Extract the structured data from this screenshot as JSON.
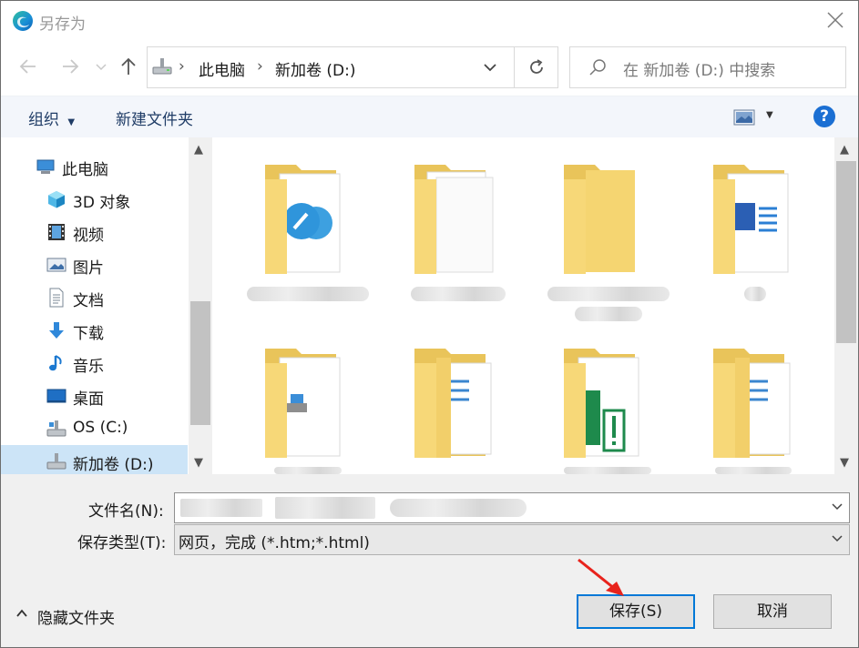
{
  "window": {
    "title": "另存为"
  },
  "nav": {
    "breadcrumb": [
      "此电脑",
      "新加卷 (D:)"
    ],
    "search_placeholder": "在 新加卷 (D:) 中搜索"
  },
  "toolbar": {
    "organize_label": "组织",
    "new_folder_label": "新建文件夹",
    "help_label": "?"
  },
  "sidebar": {
    "items": [
      {
        "label": "此电脑",
        "icon": "computer-icon"
      },
      {
        "label": "3D 对象",
        "icon": "cube-3d-icon"
      },
      {
        "label": "视频",
        "icon": "video-icon"
      },
      {
        "label": "图片",
        "icon": "pictures-icon"
      },
      {
        "label": "文档",
        "icon": "documents-icon"
      },
      {
        "label": "下载",
        "icon": "download-icon"
      },
      {
        "label": "音乐",
        "icon": "music-icon"
      },
      {
        "label": "桌面",
        "icon": "desktop-icon"
      },
      {
        "label": "OS (C:)",
        "icon": "drive-icon"
      },
      {
        "label": "新加卷 (D:)",
        "icon": "drive-icon",
        "selected": true
      }
    ]
  },
  "form": {
    "filename_label": "文件名(N):",
    "filetype_label": "保存类型(T):",
    "filetype_value": "网页，完成 (*.htm;*.html)"
  },
  "footer": {
    "hide_folders_label": "隐藏文件夹",
    "save_label": "保存(S)",
    "cancel_label": "取消"
  },
  "colors": {
    "accent": "#0078d7",
    "selection": "#cce4f7",
    "folder": "#f8d775",
    "annotation_arrow": "#e8231c"
  }
}
